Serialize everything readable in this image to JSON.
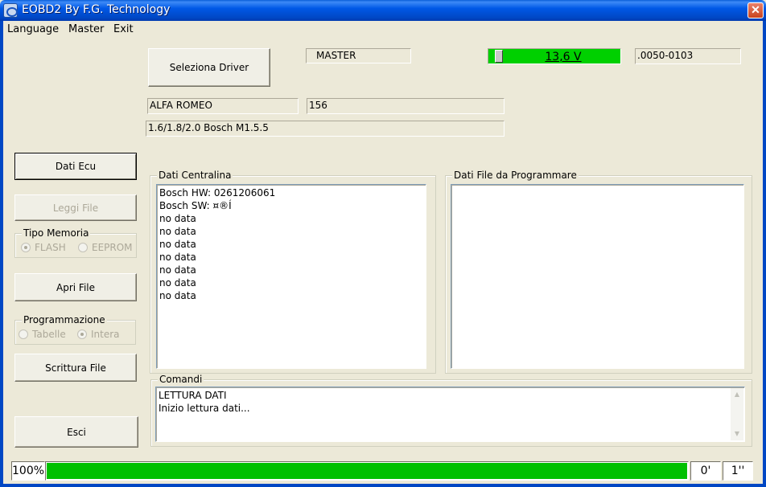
{
  "window": {
    "title": "EOBD2 By F.G. Technology",
    "close_label": "✕"
  },
  "menu": {
    "items": [
      "Language",
      "Master",
      "Exit"
    ]
  },
  "header": {
    "select_driver_label": "Seleziona Driver",
    "master_label": "MASTER",
    "voltage": "13,6 V",
    "version": ".0050-0103",
    "make": "ALFA ROMEO",
    "model": "156",
    "engine": "1.6/1.8/2.0  Bosch M1.5.5"
  },
  "left_panel": {
    "dati_ecu_label": "Dati Ecu",
    "leggi_file_label": "Leggi File",
    "tipo_memoria": {
      "legend": "Tipo Memoria",
      "option1": "FLASH",
      "option2": "EEPROM",
      "selected": "FLASH"
    },
    "apri_file_label": "Apri File",
    "programmazione": {
      "legend": "Programmazione",
      "option1": "Tabelle",
      "option2": "Intera",
      "selected": "Intera"
    },
    "scrittura_file_label": "Scrittura File",
    "esci_label": "Esci"
  },
  "dati_centralina": {
    "legend": "Dati Centralina",
    "rows": [
      "Bosch HW: 0261206061",
      "Bosch SW: ¤®Í",
      "no data",
      "no data",
      "no data",
      "no data",
      "no data",
      "no data",
      "no data"
    ]
  },
  "dati_file": {
    "legend": "Dati File da Programmare"
  },
  "comandi": {
    "legend": "Comandi",
    "lines": [
      "LETTURA DATI",
      "Inizio lettura dati..."
    ]
  },
  "status": {
    "percent": "100%",
    "progress": 1.0,
    "time_min": "0'",
    "time_sec": "1''"
  },
  "colors": {
    "progress": "#00c000",
    "voltage_bg": "#00d000",
    "titlebar": "#0058e6"
  },
  "icons": {
    "app": "eobd-app-icon",
    "close": "close-icon",
    "scroll_up": "scroll-up-arrow-icon",
    "scroll_down": "scroll-down-arrow-icon"
  }
}
